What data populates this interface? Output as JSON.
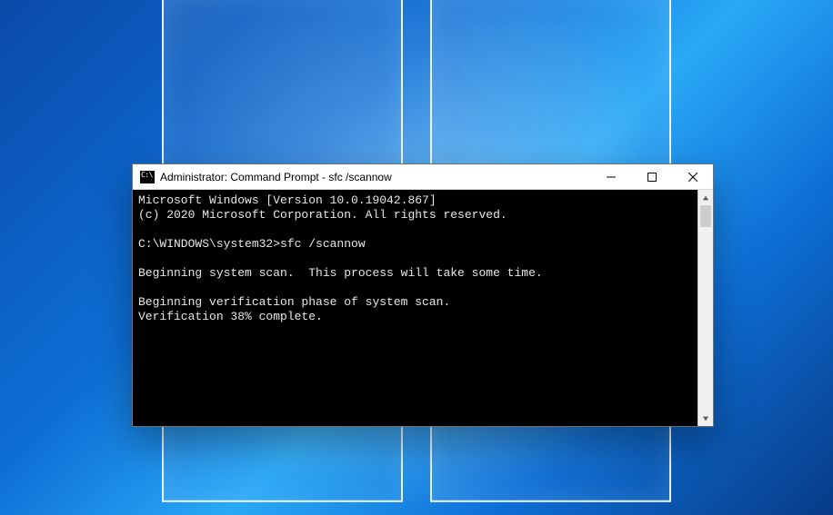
{
  "window": {
    "title": "Administrator: Command Prompt - sfc  /scannow"
  },
  "terminal": {
    "line1": "Microsoft Windows [Version 10.0.19042.867]",
    "line2": "(c) 2020 Microsoft Corporation. All rights reserved.",
    "blank1": "",
    "prompt": "C:\\WINDOWS\\system32>sfc /scannow",
    "blank2": "",
    "line3": "Beginning system scan.  This process will take some time.",
    "blank3": "",
    "line4": "Beginning verification phase of system scan.",
    "line5": "Verification 38% complete."
  }
}
